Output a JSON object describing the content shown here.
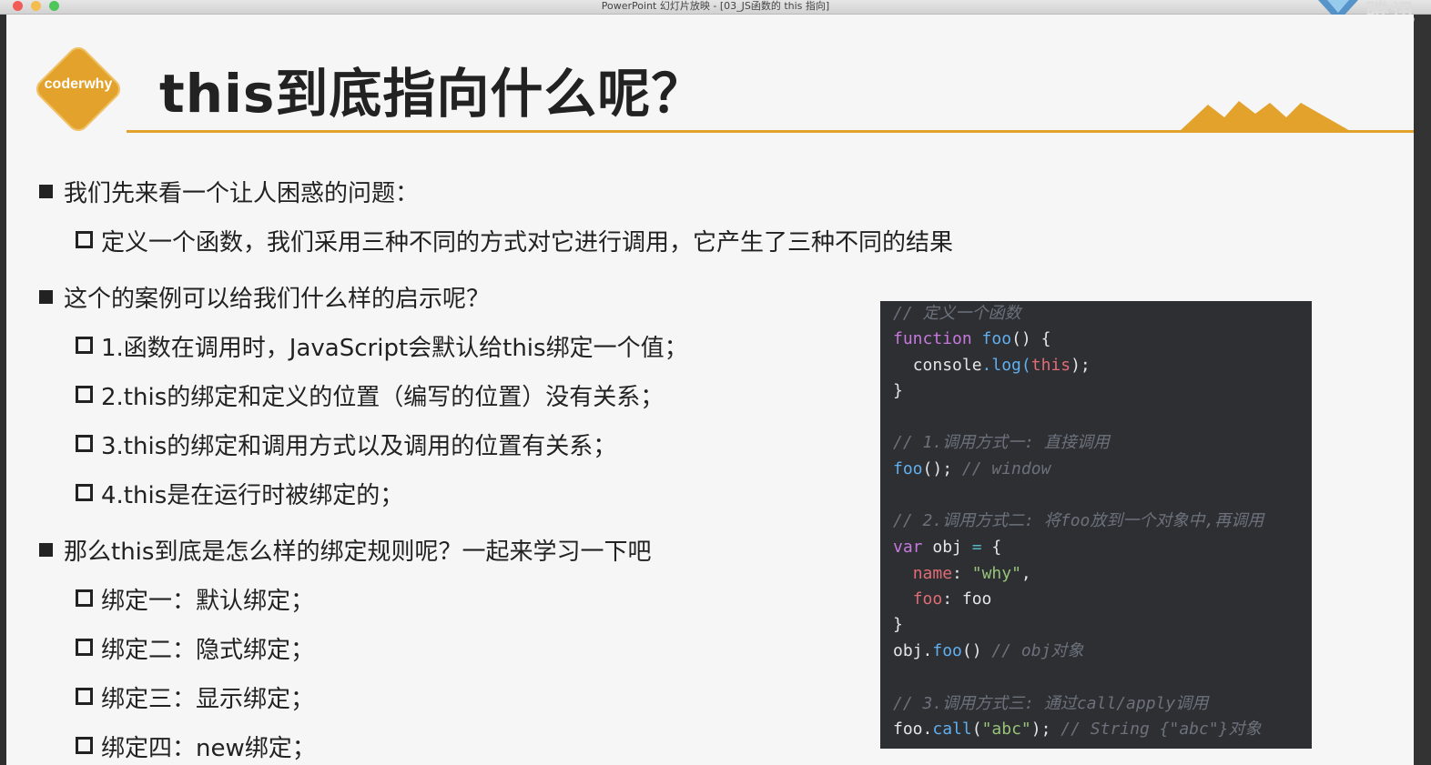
{
  "window": {
    "title": "PowerPoint 幻灯片放映 - [03_JS函数的 this 指向]",
    "corner_brand": "腾讯"
  },
  "slide": {
    "logo_text": "coderwhy",
    "title": "this到底指向什么呢？",
    "bullets": [
      {
        "text": "我们先来看一个让人困惑的问题：",
        "children": [
          "定义一个函数，我们采用三种不同的方式对它进行调用，它产生了三种不同的结果"
        ]
      },
      {
        "text": "这个的案例可以给我们什么样的启示呢？",
        "children": [
          "1.函数在调用时，JavaScript会默认给this绑定一个值；",
          "2.this的绑定和定义的位置（编写的位置）没有关系；",
          "3.this的绑定和调用方式以及调用的位置有关系；",
          "4.this是在运行时被绑定的；"
        ]
      },
      {
        "text": "那么this到底是怎么样的绑定规则呢？一起来学习一下吧",
        "children": [
          "绑定一：默认绑定；",
          "绑定二：隐式绑定；",
          "绑定三：显示绑定；",
          "绑定四：new绑定；"
        ]
      }
    ],
    "code": {
      "comment_define": "// 定义一个函数",
      "kw_function": "function",
      "fn_foo": "foo",
      "paren_brace": "() {",
      "console": "console",
      "dot_log": ".log(",
      "this": "this",
      "close_paren": ");",
      "close_brace": "}",
      "comment_call1": "// 1.调用方式一: 直接调用",
      "call1_fn": "foo",
      "call1_rest": "();",
      "call1_comment": "// window",
      "comment_call2": "// 2.调用方式二: 将foo放到一个对象中,再调用",
      "kw_var": "var",
      "obj_name": " obj ",
      "eq": "=",
      "open_brace": " {",
      "prop_name": "name",
      "colon1": ": ",
      "str_why": "\"why\"",
      "comma": ",",
      "prop_foo": "foo",
      "colon2": ": foo",
      "obj_call_obj": "obj.",
      "obj_call_fn": "foo",
      "obj_call_rest": "()",
      "obj_call_comment": "// obj对象",
      "comment_call3": "// 3.调用方式三: 通过call/apply调用",
      "call3_foo": "foo.",
      "call3_call": "call",
      "call3_open": "(",
      "call3_str": "\"abc\"",
      "call3_close": ");",
      "call3_comment": "// String {\"abc\"}对象"
    }
  }
}
